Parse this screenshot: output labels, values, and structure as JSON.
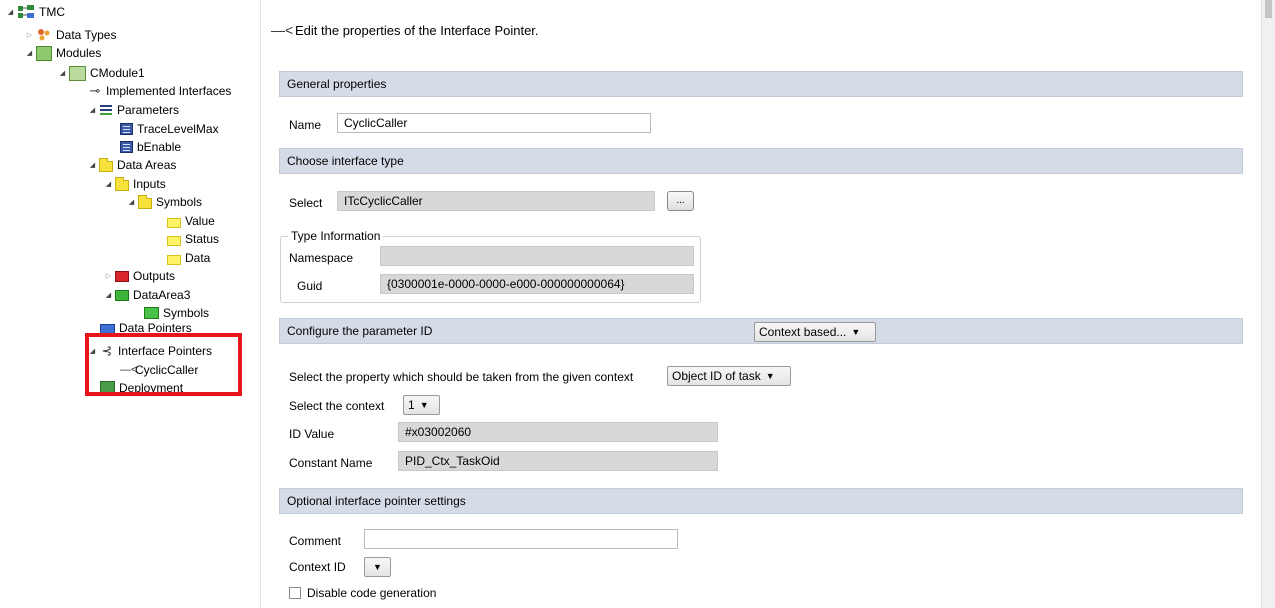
{
  "tree": {
    "tmc": "TMC",
    "data_types": "Data Types",
    "modules": "Modules",
    "cmodule1": "CModule1",
    "implemented_interfaces": "Implemented Interfaces",
    "parameters": "Parameters",
    "trace_level_max": "TraceLevelMax",
    "b_enable": "bEnable",
    "data_areas": "Data Areas",
    "inputs": "Inputs",
    "symbols": "Symbols",
    "value": "Value",
    "status": "Status",
    "data": "Data",
    "outputs": "Outputs",
    "data_area3": "DataArea3",
    "symbols2": "Symbols",
    "data_pointers": "Data Pointers",
    "interface_pointers": "Interface Pointers",
    "cyclic_caller": "CyclicCaller",
    "deployment": "Deployment"
  },
  "header": {
    "text": "Edit the properties of the Interface Pointer."
  },
  "general": {
    "title": "General properties",
    "name_label": "Name",
    "name_value": "CyclicCaller"
  },
  "interface_type": {
    "title": "Choose interface type",
    "select_label": "Select",
    "select_value": "ITcCyclicCaller",
    "browse_label": "...",
    "type_info_legend": "Type Information",
    "namespace_label": "Namespace",
    "namespace_value": "",
    "guid_label": "Guid",
    "guid_value": "{0300001e-0000-0000-e000-000000000064}"
  },
  "parameter_id": {
    "title": "Configure the parameter ID",
    "mode_value": "Context based...",
    "property_label": "Select the property which should be taken from the given context",
    "property_value": "Object ID of task",
    "context_label": "Select the context",
    "context_value": "1",
    "id_value_label": "ID Value",
    "id_value": "#x03002060",
    "constant_name_label": "Constant Name",
    "constant_name_value": "PID_Ctx_TaskOid"
  },
  "optional": {
    "title": "Optional interface pointer settings",
    "comment_label": "Comment",
    "comment_value": "",
    "context_id_label": "Context ID",
    "context_id_value": "",
    "disable_codegen_label": "Disable code generation",
    "disable_codegen_checked": false
  },
  "colors": {
    "section_bg": "#d6dce7",
    "highlight": "#e8141c",
    "readonly_bg": "#d8d8d8"
  }
}
